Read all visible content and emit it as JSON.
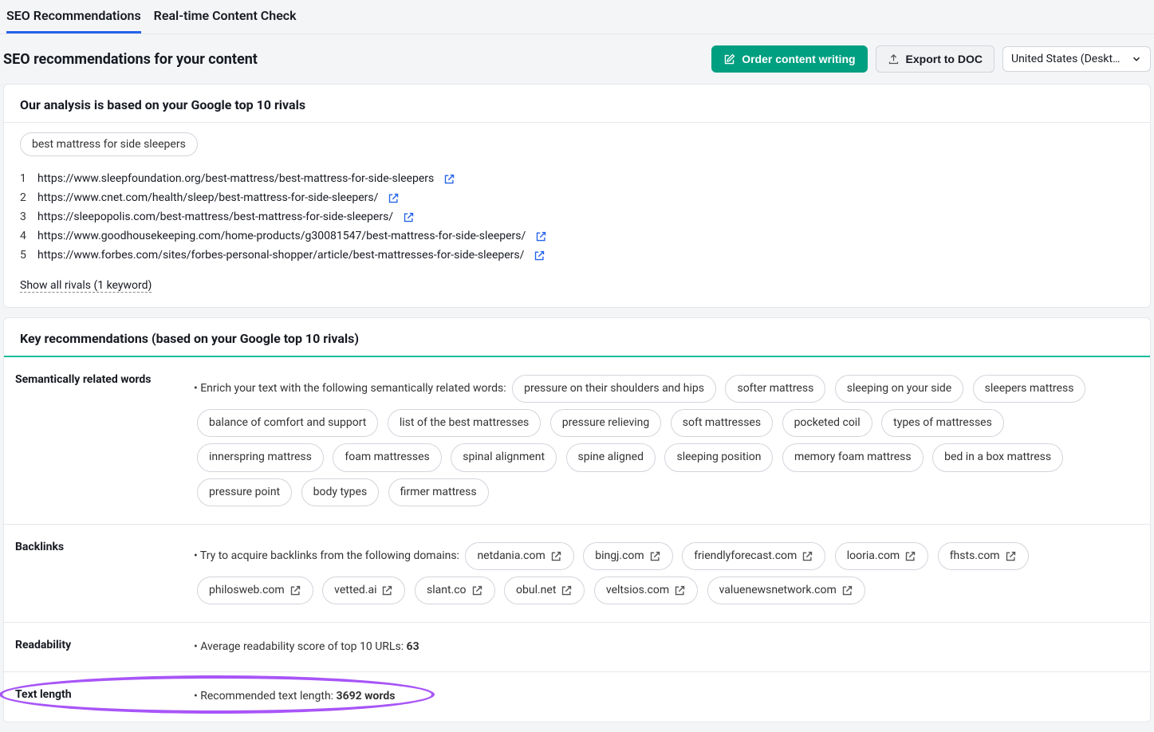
{
  "tabs": [
    {
      "label": "SEO Recommendations",
      "active": true
    },
    {
      "label": "Real-time Content Check",
      "active": false
    }
  ],
  "page_title": "SEO recommendations for your content",
  "actions": {
    "order_label": "Order content writing",
    "export_label": "Export to DOC",
    "region_label": "United States (Deskt…"
  },
  "analysis": {
    "heading": "Our analysis is based on your Google top 10 rivals",
    "keyword": "best mattress for side sleepers",
    "rivals": [
      {
        "n": "1",
        "url": "https://www.sleepfoundation.org/best-mattress/best-mattress-for-side-sleepers"
      },
      {
        "n": "2",
        "url": "https://www.cnet.com/health/sleep/best-mattress-for-side-sleepers/"
      },
      {
        "n": "3",
        "url": "https://sleepopolis.com/best-mattress/best-mattress-for-side-sleepers/"
      },
      {
        "n": "4",
        "url": "https://www.goodhousekeeping.com/home-products/g30081547/best-mattress-for-side-sleepers/"
      },
      {
        "n": "5",
        "url": "https://www.forbes.com/sites/forbes-personal-shopper/article/best-mattresses-for-side-sleepers/"
      }
    ],
    "show_all": "Show all rivals (1 keyword)"
  },
  "key_recs": {
    "heading": "Key recommendations (based on your Google top 10 rivals)",
    "semantic": {
      "label": "Semantically related words",
      "lead": "• Enrich your text with the following semantically related words:",
      "words": [
        "pressure on their shoulders and hips",
        "softer mattress",
        "sleeping on your side",
        "sleepers mattress",
        "balance of comfort and support",
        "list of the best mattresses",
        "pressure relieving",
        "soft mattresses",
        "pocketed coil",
        "types of mattresses",
        "innerspring mattress",
        "foam mattresses",
        "spinal alignment",
        "spine aligned",
        "sleeping position",
        "memory foam mattress",
        "bed in a box mattress",
        "pressure point",
        "body types",
        "firmer mattress"
      ]
    },
    "backlinks": {
      "label": "Backlinks",
      "lead": "• Try to acquire backlinks from the following domains:",
      "domains": [
        "netdania.com",
        "bingj.com",
        "friendlyforecast.com",
        "looria.com",
        "fhsts.com",
        "philosweb.com",
        "vetted.ai",
        "slant.co",
        "obul.net",
        "veltsios.com",
        "valuenewsnetwork.com"
      ]
    },
    "readability": {
      "label": "Readability",
      "lead": "• Average readability score of top 10 URLs: ",
      "value": "63"
    },
    "textlength": {
      "label": "Text length",
      "lead": "• Recommended text length: ",
      "value": "3692 words"
    }
  }
}
